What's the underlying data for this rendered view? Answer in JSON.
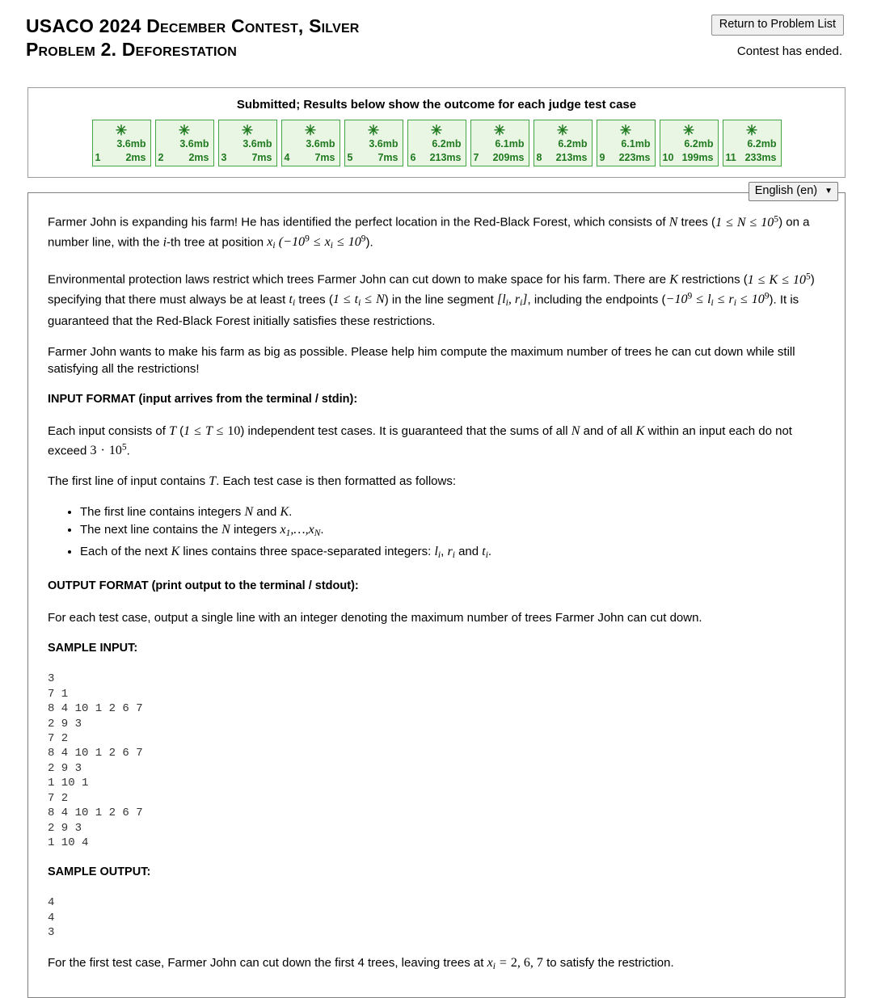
{
  "header": {
    "title_line1": "USACO 2024 December Contest, Silver",
    "title_line2": "Problem 2. Deforestation",
    "return_button": "Return to Problem List",
    "contest_status": "Contest has ended."
  },
  "results": {
    "title": "Submitted; Results below show the outcome for each judge test case",
    "star_glyph": "✳",
    "border_color": "#44a544",
    "background_color": "#eaf6e4",
    "text_color": "#1f7a1f",
    "cases": [
      {
        "num": "1",
        "memory": "3.6mb",
        "time": "2ms"
      },
      {
        "num": "2",
        "memory": "3.6mb",
        "time": "2ms"
      },
      {
        "num": "3",
        "memory": "3.6mb",
        "time": "7ms"
      },
      {
        "num": "4",
        "memory": "3.6mb",
        "time": "7ms"
      },
      {
        "num": "5",
        "memory": "3.6mb",
        "time": "7ms"
      },
      {
        "num": "6",
        "memory": "6.2mb",
        "time": "213ms"
      },
      {
        "num": "7",
        "memory": "6.1mb",
        "time": "209ms"
      },
      {
        "num": "8",
        "memory": "6.2mb",
        "time": "213ms"
      },
      {
        "num": "9",
        "memory": "6.1mb",
        "time": "223ms"
      },
      {
        "num": "10",
        "memory": "6.2mb",
        "time": "199ms"
      },
      {
        "num": "11",
        "memory": "6.2mb",
        "time": "233ms"
      }
    ]
  },
  "language": {
    "selected": "English (en)",
    "chevron": "⌄"
  },
  "problem": {
    "intro_a": "Farmer John is expanding his farm! He has identified the perfect location in the Red-Black Forest, which consists of",
    "intro_b": "trees (",
    "intro_c": ") on a number line, with the",
    "intro_d": "-th tree at position",
    "intro_e": ").",
    "restrictions_a": "Environmental protection laws restrict which trees Farmer John can cut down to make space for his farm. There are",
    "restrictions_b": "restrictions (",
    "restrictions_c": ") specifying that there must always be at least",
    "restrictions_d": "trees (",
    "restrictions_e": ") in the line segment",
    "restrictions_f": ", including the endpoints (",
    "restrictions_g": "). It is guaranteed that the Red-Black Forest initially satisfies these restrictions.",
    "goal": "Farmer John wants to make his farm as big as possible. Please help him compute the maximum number of trees he can cut down while still satisfying all the restrictions!",
    "input_format_heading": "INPUT FORMAT (input arrives from the terminal / stdin):",
    "input_a": "Each input consists of",
    "input_b": "(",
    "input_c": ") independent test cases. It is guaranteed that the sums of all",
    "input_d": "and of all",
    "input_e": "within an input each do not exceed",
    "input_f": ".",
    "first_line_a": "The first line of input contains",
    "first_line_b": ". Each test case is then formatted as follows:",
    "bullet1_a": "The first line contains integers",
    "bullet1_b": "and",
    "bullet1_c": ".",
    "bullet2_a": "The next line contains the",
    "bullet2_b": "integers",
    "bullet2_c": ".",
    "bullet3_a": "Each of the next",
    "bullet3_b": "lines contains three space-separated integers:",
    "bullet3_c": ",",
    "bullet3_d": "and",
    "bullet3_e": ".",
    "output_format_heading": "OUTPUT FORMAT (print output to the terminal / stdout):",
    "output_desc": "For each test case, output a single line with an integer denoting the maximum number of trees Farmer John can cut down.",
    "sample_input_heading": "SAMPLE INPUT:",
    "sample_input": "3\n7 1\n8 4 10 1 2 6 7\n2 9 3\n7 2\n8 4 10 1 2 6 7\n2 9 3\n1 10 1\n7 2\n8 4 10 1 2 6 7\n2 9 3\n1 10 4",
    "sample_output_heading": "SAMPLE OUTPUT:",
    "sample_output": "4\n4\n3",
    "explanation_a": "For the first test case, Farmer John can cut down the first 4 trees, leaving trees at",
    "explanation_b": "to satisfy the restriction.",
    "math": {
      "N": "N",
      "K": "K",
      "T": "T",
      "i": "i",
      "n_range": "1 ≤ N ≤ 10^5",
      "x_range": "−10^9 ≤ x_i ≤ 10^9",
      "k_range": "1 ≤ K ≤ 10^5",
      "t_range": "1 ≤ t_i ≤ N",
      "lr_range": "−10^9 ≤ l_i ≤ r_i ≤ 10^9",
      "t_count": "T",
      "t_range_10": "1 ≤ T ≤ 10",
      "sum_limit": "3 · 10^5",
      "segment": "[l_i, r_i]",
      "x_list": "x_1,…,x_N",
      "x_values": "x_i = 2, 6, 7"
    }
  }
}
